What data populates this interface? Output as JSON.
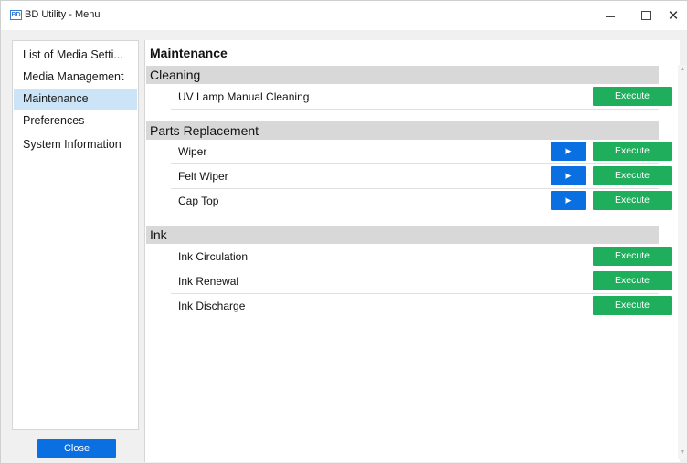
{
  "window": {
    "app_icon": "BD",
    "title": "BD Utility - Menu",
    "minimize_label": "–",
    "close_glyph": "✕"
  },
  "sidebar": {
    "items": [
      {
        "label": "List of Media Setti..."
      },
      {
        "label": "Media Management"
      },
      {
        "label": "Maintenance",
        "active": true
      },
      {
        "label": "Preferences"
      },
      {
        "label": "System Information"
      }
    ],
    "close_label": "Close"
  },
  "main": {
    "title": "Maintenance",
    "sections": [
      {
        "header": "Cleaning",
        "rows": [
          {
            "label": "UV Lamp Manual Cleaning",
            "execute": "Execute"
          }
        ]
      },
      {
        "header": "Parts Replacement",
        "rows": [
          {
            "label": "Wiper",
            "play": "▶",
            "execute": "Execute"
          },
          {
            "label": "Felt Wiper",
            "play": "▶",
            "execute": "Execute"
          },
          {
            "label": "Cap Top",
            "play": "▶",
            "execute": "Execute"
          }
        ]
      },
      {
        "header": "Ink",
        "rows": [
          {
            "label": "Ink Circulation",
            "execute": "Execute"
          },
          {
            "label": "Ink Renewal",
            "execute": "Execute"
          },
          {
            "label": "Ink Discharge",
            "execute": "Execute"
          }
        ]
      }
    ]
  },
  "colors": {
    "execute": "#1fae5c",
    "primary": "#0a6fe0",
    "selected": "#cce4f7",
    "section_header": "#d8d8d8"
  },
  "icons": {
    "play": "play-icon",
    "minimize": "minimize-icon",
    "maximize": "maximize-icon",
    "close": "close-icon",
    "scroll_up": "scroll-up-icon",
    "scroll_down": "scroll-down-icon"
  }
}
